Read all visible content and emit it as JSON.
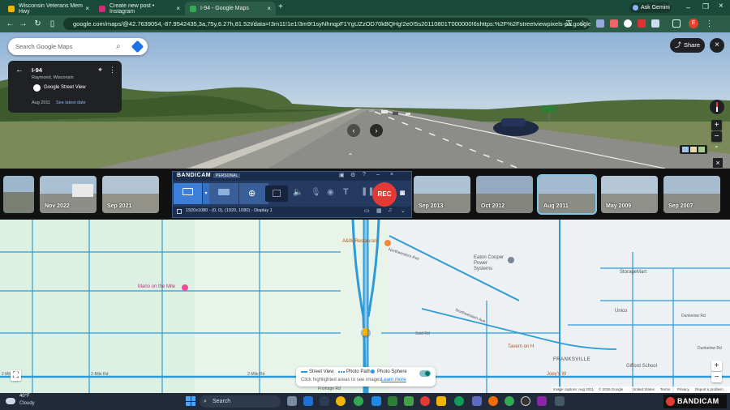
{
  "browser": {
    "tabs": [
      {
        "title": "Wisconsin Veterans Mem Hwy",
        "favicon_color": "#f2b600",
        "active": false
      },
      {
        "title": "Create new post • Instagram",
        "favicon_color": "#d62976",
        "active": false
      },
      {
        "title": "I-94 - Google Maps",
        "favicon_color": "#34a853",
        "active": true
      }
    ],
    "new_tab": "+",
    "ask_gemini": "Ask Gemini",
    "profile_initial": "E",
    "url": "google.com/maps/@42.7639054,-87.9542435,3a,75y,6.27h,81.52t/data=!3m11!1e1!3m9!1syNhnqpF1YgUZzOD70kBQHg!2e0!5s20110801T000000!6shttps:%2F%2Fstreetviewpixels-pa.googleapis.com%2Fv1..."
  },
  "maps": {
    "search_placeholder": "Search Google Maps",
    "share_label": "Share",
    "info_card": {
      "title": "I-94",
      "subtitle": "Raymond, Wisconsin",
      "source": "Google Street View",
      "date": "Aug 2011",
      "latest_link": "See latest date"
    },
    "filmstrip": [
      {
        "label": "",
        "color": "#8aa0b0"
      },
      {
        "label": "Nov 2022",
        "color": "#9fb4c4"
      },
      {
        "label": "Sep 2021",
        "color": "#a9bccb"
      },
      {
        "label": "Sep 2013",
        "color": "#a8bdd0"
      },
      {
        "label": "Oct 2012",
        "color": "#8ea6bd"
      },
      {
        "label": "Aug 2011",
        "color": "#9fb6cc"
      },
      {
        "label": "May 2009",
        "color": "#b0c2d3"
      },
      {
        "label": "Sep 2007",
        "color": "#a4b8cb"
      }
    ],
    "map_labels": {
      "restaurant": "A&W Restaurant",
      "mario": "Mario on the Mile",
      "eaton": "Eaton Cooper Power Systems",
      "storage": "StorageMart",
      "unico": "Unico",
      "tavern": "Tavern on H",
      "franksville": "FRANKSVILLE",
      "gifford": "Gifford School",
      "joeys": "Joey's W",
      "twomile_left": "2 Mile Rd",
      "twomile_mid": "2-Mile Rd",
      "twomile_center": "2-Mile Rd",
      "northwestern": "Northwestern Ave",
      "northwestern2": "Northwestern Ave",
      "sold": "Sold Rd",
      "dunkelow": "Dunkelow Rd",
      "dunkelow2": "Dunkelow Rd",
      "route": "Frontage Rd"
    },
    "legend": {
      "street_view": "Street View",
      "photo_path": "Photo Path",
      "photo_sphere": "Photo Sphere",
      "hint": "Click highlighted areas to see images",
      "learn_more": "Learn more"
    },
    "footer": {
      "capture": "Image capture: Aug 2011",
      "copyright": "© 2026 Google",
      "region": "United States",
      "terms": "Terms",
      "privacy": "Privacy",
      "report": "Report a problem"
    }
  },
  "bandicam": {
    "brand": "BANDICAM",
    "edition": "PERSONAL",
    "display_info": "1920x1080 - (0, 0), (1920, 1080) - Display 1",
    "rec_label": "REC",
    "watermark": "BANDICAM"
  },
  "taskbar": {
    "weather_temp": "40°F",
    "weather_text": "Cloudy",
    "search_label": "Search"
  }
}
